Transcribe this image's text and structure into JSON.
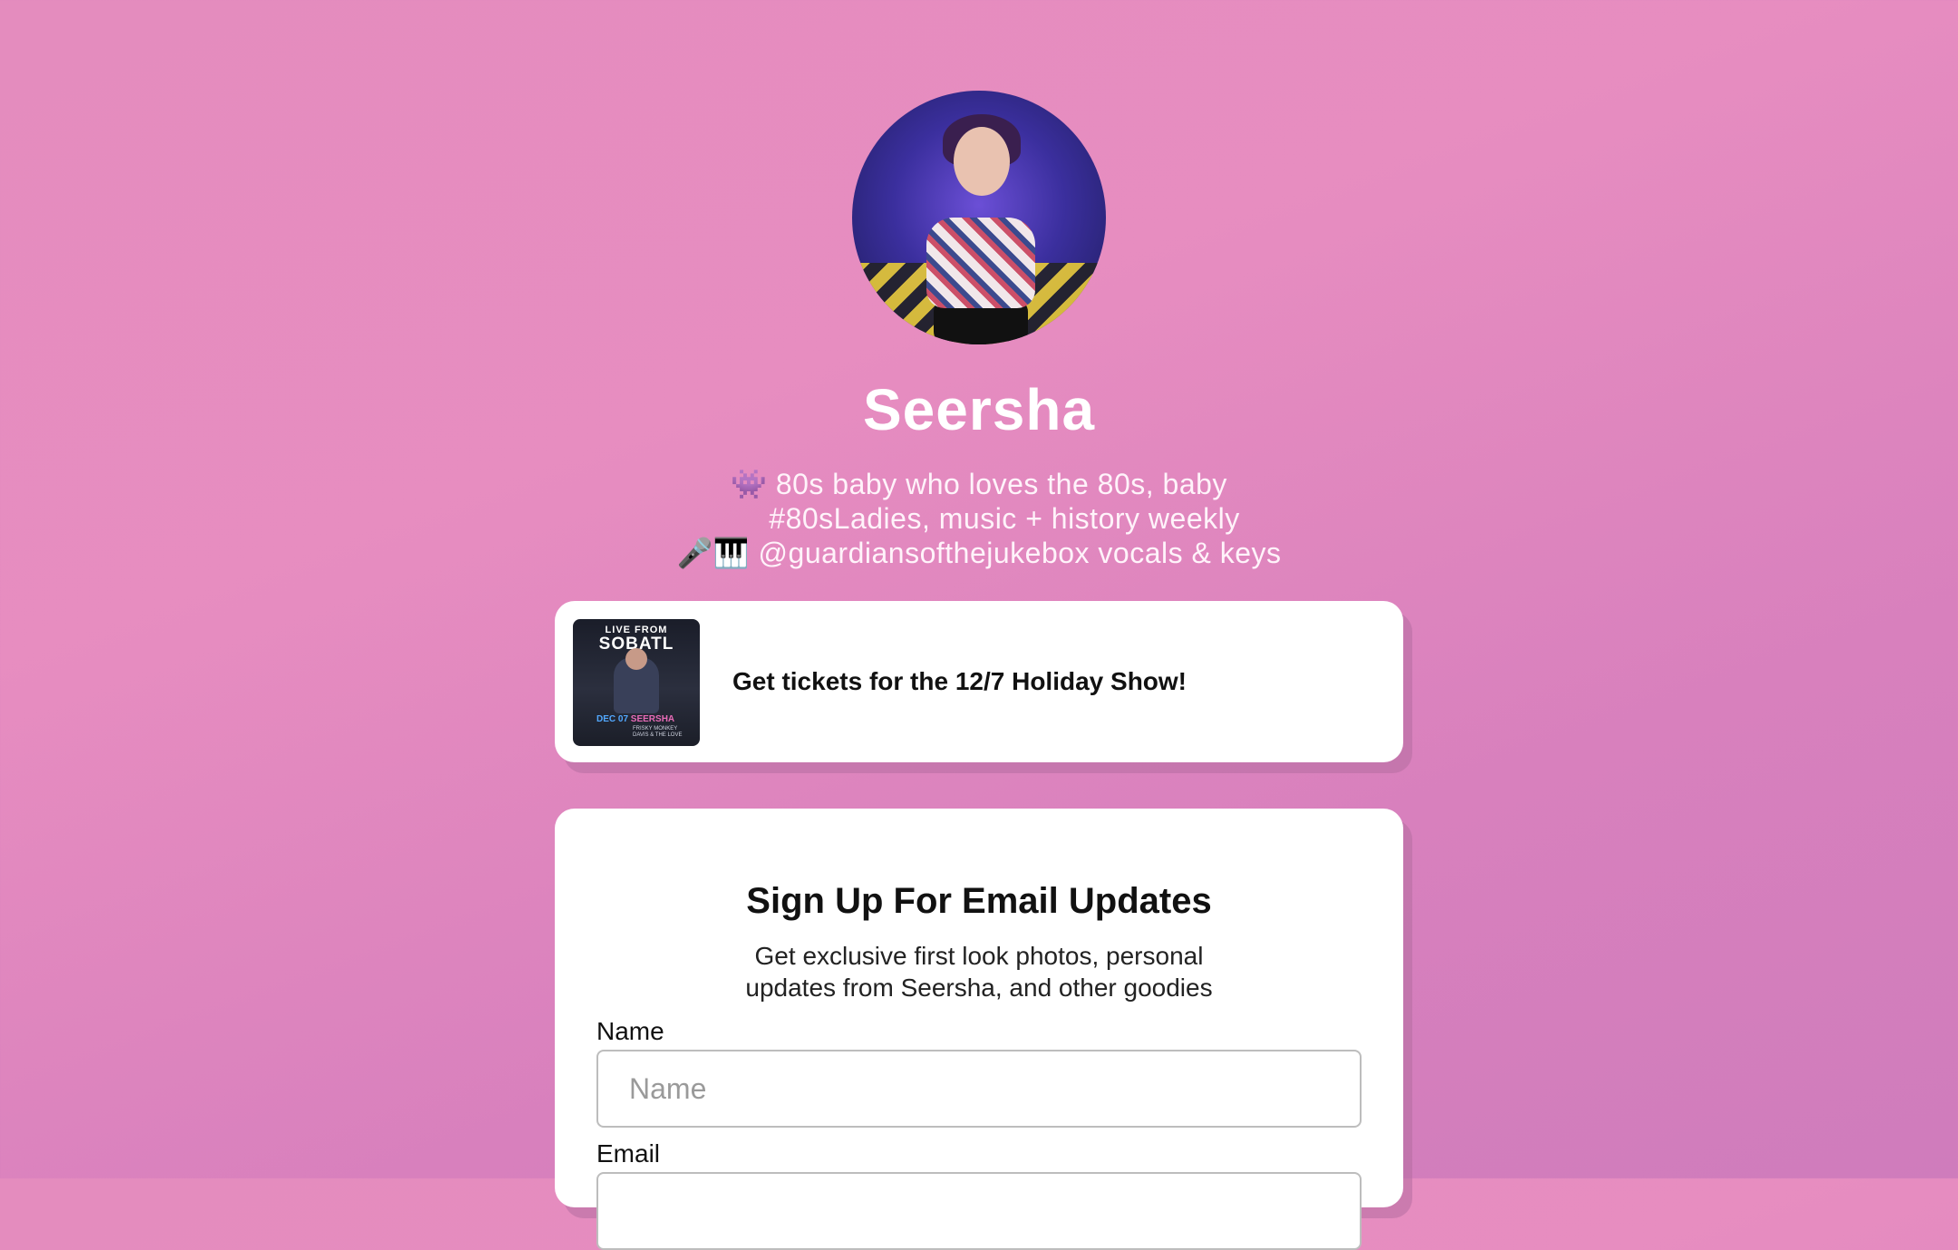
{
  "profile": {
    "name": "Seersha",
    "bio_lines": [
      "👾 80s baby who loves the 80s, baby",
      "#80sLadies, music + history weekly",
      "🎤🎹 @guardiansofthejukebox vocals & keys"
    ]
  },
  "links": [
    {
      "label": "Get tickets for the 12/7 Holiday Show!",
      "thumbnail": {
        "line1": "LIVE FROM",
        "line2": "SOBATL",
        "date": "DEC 07",
        "artist": "SEERSHA",
        "support": "FRISKY MONKEY\nDAVIS & THE LOVE"
      }
    }
  ],
  "signup": {
    "title": "Sign Up For Email Updates",
    "description_lines": [
      "Get exclusive first look photos, personal",
      "updates from Seersha, and other goodies"
    ],
    "name_label": "Name",
    "name_placeholder": "Name",
    "email_label": "Email"
  },
  "colors": {
    "background_top": "#e78dc0",
    "background_bottom": "#cf7cbc",
    "card": "#ffffff",
    "text_dark": "#111111"
  }
}
